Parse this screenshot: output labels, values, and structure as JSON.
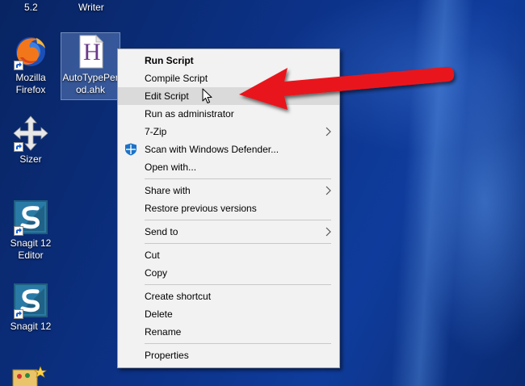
{
  "desktop": {
    "top_labels": [
      "5.2",
      "Writer"
    ],
    "icons": [
      {
        "label_line1": "Mozilla",
        "label_line2": "Firefox",
        "icon": "firefox-icon"
      },
      {
        "label_line1": "AutoTypePer",
        "label_line2": "od.ahk",
        "icon": "autohotkey-script-icon",
        "selected": true
      },
      {
        "label_line1": "Sizer",
        "label_line2": "",
        "icon": "move-arrows-icon"
      },
      {
        "label_line1": "Snagit 12",
        "label_line2": "Editor",
        "icon": "snagit-icon"
      },
      {
        "label_line1": "Snagit 12",
        "label_line2": "",
        "icon": "snagit-icon"
      }
    ],
    "ahk_letter": "H"
  },
  "context_menu": {
    "items": [
      {
        "label": "Run Script",
        "bold": true
      },
      {
        "label": "Compile Script"
      },
      {
        "label": "Edit Script",
        "highlighted": true
      },
      {
        "label": "Run as administrator"
      },
      {
        "label": "7-Zip",
        "submenu": true
      },
      {
        "label": "Scan with Windows Defender...",
        "icon": "windows-defender-icon"
      },
      {
        "label": "Open with..."
      },
      {
        "label": "Share with",
        "submenu": true
      },
      {
        "label": "Restore previous versions"
      },
      {
        "label": "Send to",
        "submenu": true
      },
      {
        "label": "Cut"
      },
      {
        "label": "Copy"
      },
      {
        "label": "Create shortcut"
      },
      {
        "label": "Delete"
      },
      {
        "label": "Rename"
      },
      {
        "label": "Properties"
      }
    ]
  },
  "annotation": {
    "arrow_color": "#e8121a"
  }
}
